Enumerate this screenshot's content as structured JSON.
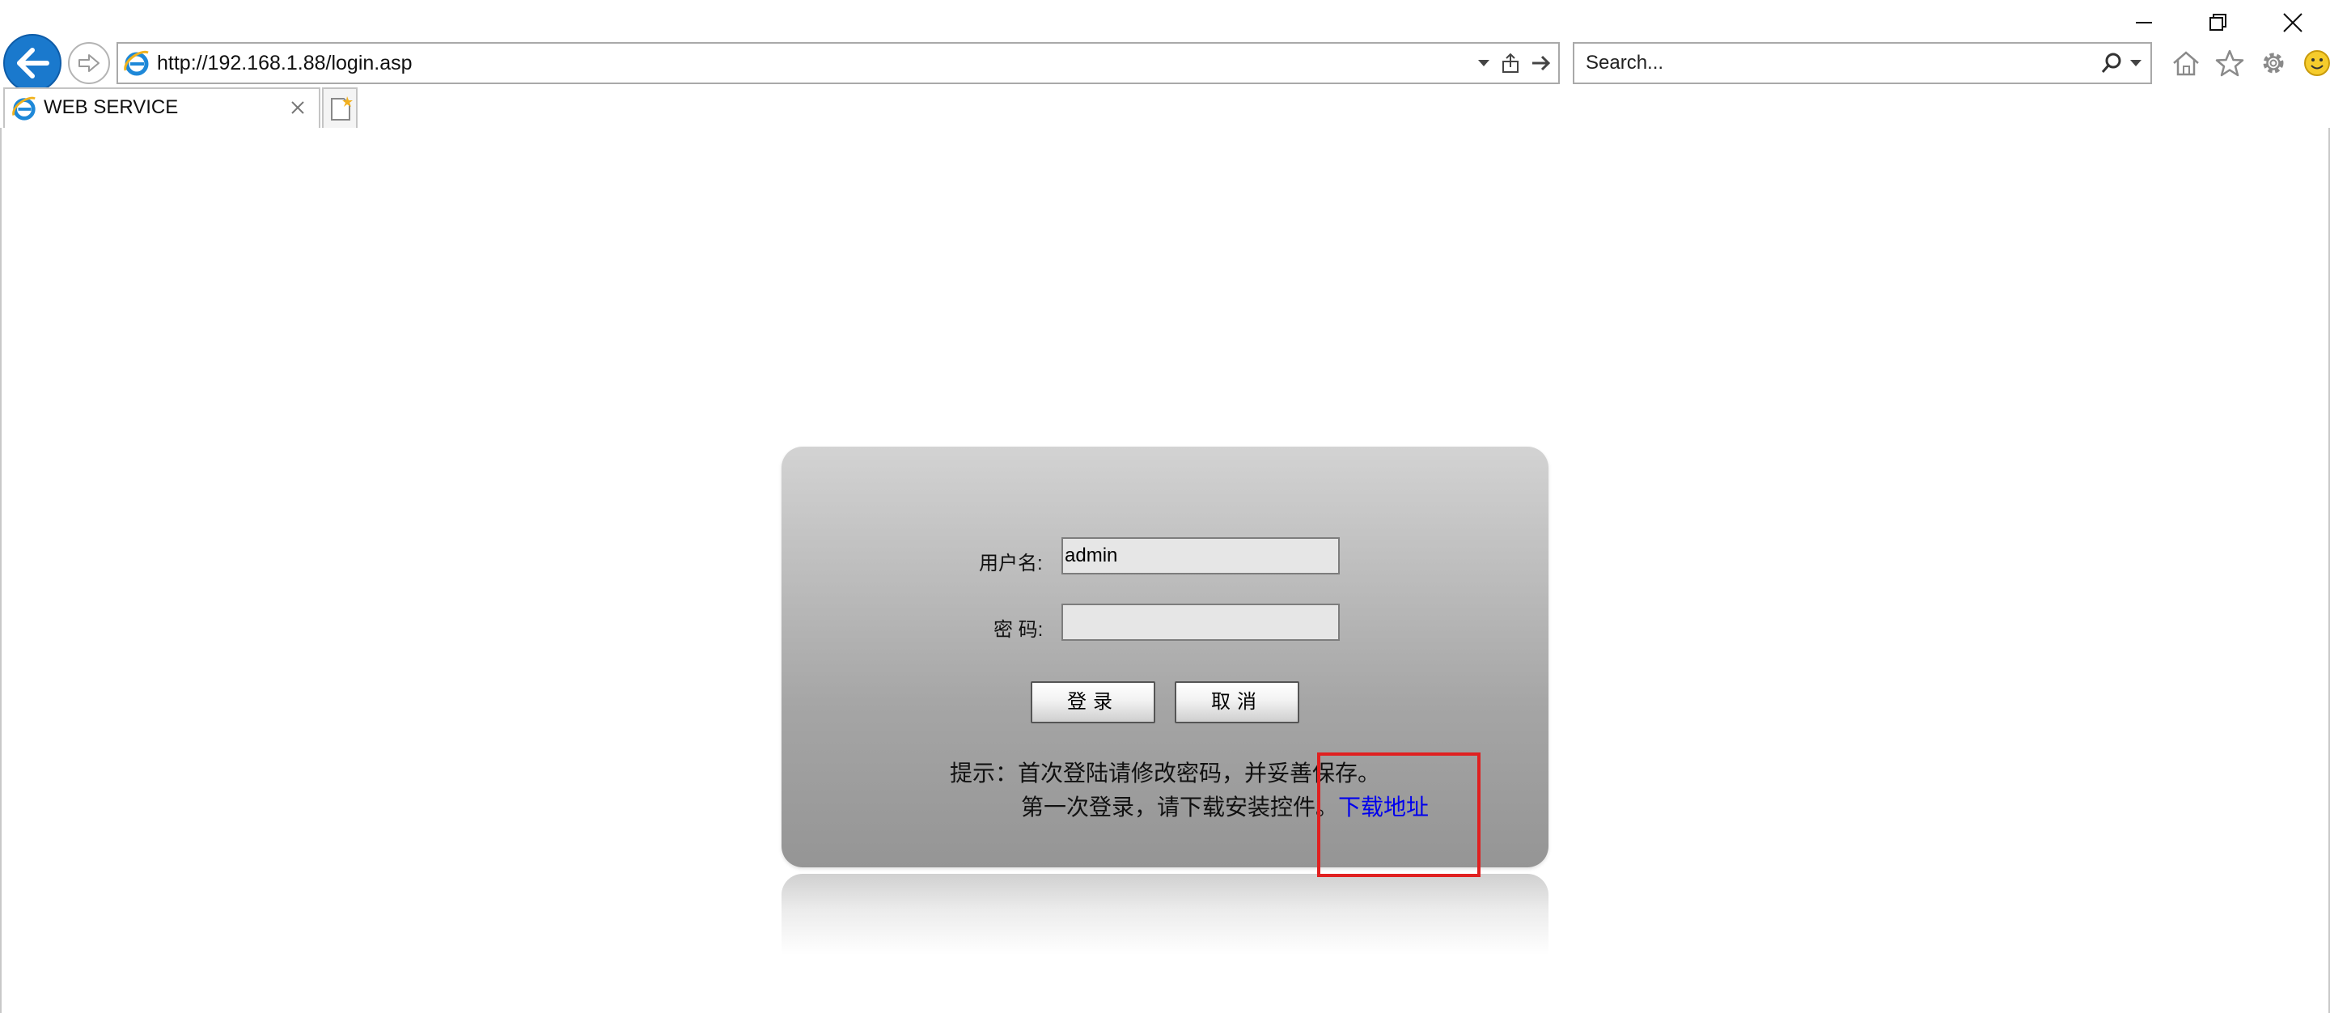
{
  "window": {
    "controls": {
      "minimize": "minimize",
      "restore": "restore",
      "close": "close"
    }
  },
  "nav": {
    "address": "http://192.168.1.88/login.asp",
    "search_placeholder": "Search..."
  },
  "tab": {
    "title": "WEB SERVICE"
  },
  "login": {
    "username_label": "用户名:",
    "username_value": "admin",
    "password_label": "密 码:",
    "password_value": "",
    "login_button": "登录",
    "cancel_button": "取消",
    "hint_line1": "提示：首次登陆请修改密码，并妥善保存。",
    "hint_line2": "第一次登录，请下载安装控件。",
    "download_link": "下载地址"
  },
  "colors": {
    "accent": "#1a79cd",
    "link": "#0000ee",
    "highlight": "#e02020"
  }
}
